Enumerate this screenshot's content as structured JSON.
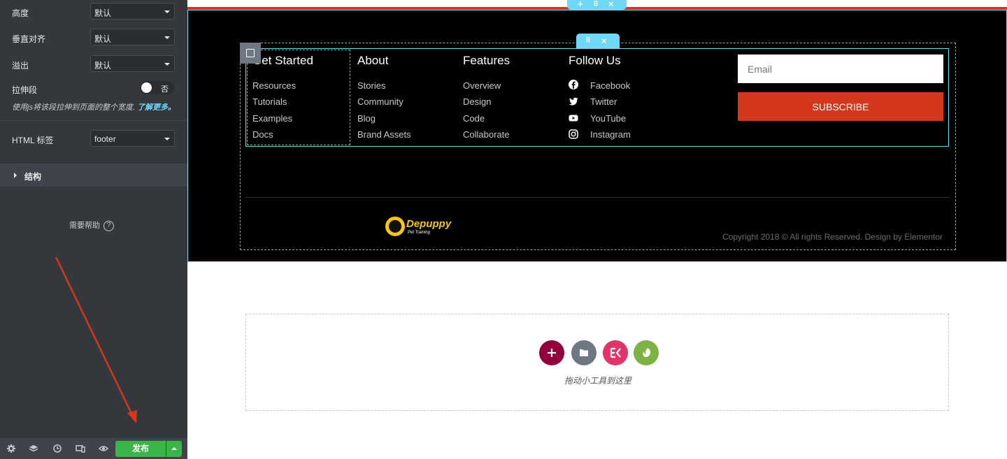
{
  "panel": {
    "controls": [
      {
        "label": "高度",
        "value": "默认"
      },
      {
        "label": "垂直对齐",
        "value": "默认"
      },
      {
        "label": "溢出",
        "value": "默认"
      }
    ],
    "stretch": {
      "label": "拉伸段",
      "toggle_text": "否",
      "description": "使用js将该段拉伸到页面的整个宽度.",
      "learn_more": "了解更多。"
    },
    "html_tag": {
      "label": "HTML 标签",
      "value": "footer"
    },
    "structure_label": "结构",
    "help_label": "需要帮助",
    "publish_label": "发布"
  },
  "footer": {
    "columns": [
      {
        "title": "Get Started",
        "links": [
          "Resources",
          "Tutorials",
          "Examples",
          "Docs"
        ]
      },
      {
        "title": "About",
        "links": [
          "Stories",
          "Community",
          "Blog",
          "Brand Assets"
        ]
      },
      {
        "title": "Features",
        "links": [
          "Overview",
          "Design",
          "Code",
          "Collaborate"
        ]
      },
      {
        "title": "Follow Us",
        "links": [
          "Facebook",
          "Twitter",
          "YouTube",
          "Instagram"
        ]
      }
    ],
    "email_placeholder": "Email",
    "subscribe_label": "SUBSCRIBE",
    "logo_name": "Depuppy",
    "logo_tagline": "Pet Training",
    "copyright": "Copyright 2018 © All rights Reserved. Design by Elementor"
  },
  "drop_zone": {
    "text": "拖动小工具到这里"
  },
  "colors": {
    "accent_red": "#d4371c",
    "editor_blue": "#71d7f7",
    "publish_green": "#39b54a",
    "logo_yellow": "#f5c518"
  }
}
